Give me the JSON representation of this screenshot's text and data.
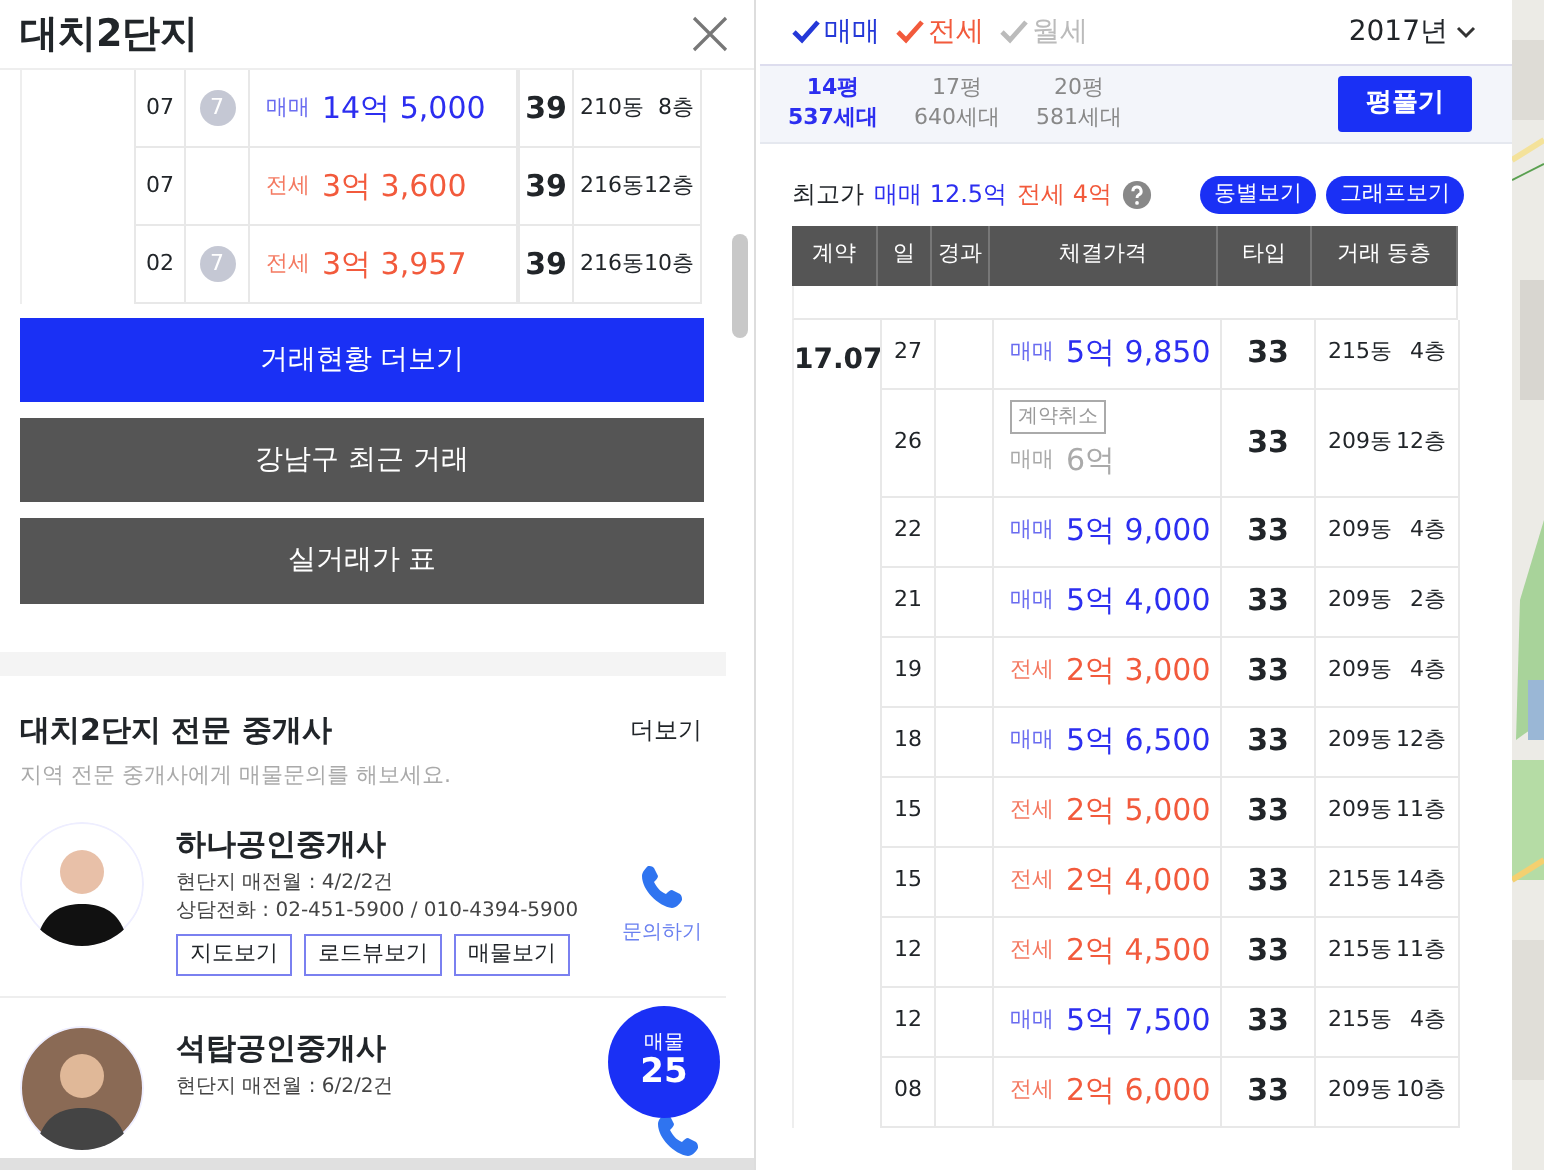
{
  "title": "대치2단지",
  "recent_trades": [
    {
      "day": "07",
      "badge": "7",
      "deal": "매매",
      "kind": "sale",
      "price": "14억 5,000",
      "type": "39",
      "building": "210동",
      "floor": "8층"
    },
    {
      "day": "07",
      "deal": "전세",
      "kind": "jeonse",
      "price": "3억 3,600",
      "type": "39",
      "building": "216동",
      "floor": "12층"
    },
    {
      "day": "02",
      "badge": "7",
      "deal": "전세",
      "kind": "jeonse",
      "price": "3억 3,957",
      "type": "39",
      "building": "216동",
      "floor": "10층"
    }
  ],
  "buttons": [
    {
      "label": "거래현황 더보기",
      "primary": true
    },
    {
      "label": "강남구 최근 거래",
      "primary": false
    },
    {
      "label": "실거래가 표",
      "primary": false
    }
  ],
  "agents_section": {
    "title": "대치2단지 전문 중개사",
    "more": "더보기",
    "subtitle": "지역 전문 중개사에게 매물문의를 해보세요."
  },
  "agents": [
    {
      "name": "하나공인중개사",
      "lines": [
        "현단지 매전월 : 4/2/2건",
        "상담전화 : 02-451-5900 / 010-4394-5900"
      ],
      "actions": [
        "지도보기",
        "로드뷰보기",
        "매물보기"
      ],
      "inquiry": "문의하기"
    },
    {
      "name": "석탑공인중개사",
      "lines": [
        "현단지 매전월 : 6/2/2건"
      ]
    }
  ],
  "listing_badge": {
    "label": "매물",
    "count": "25"
  },
  "filters": [
    {
      "label": "매매",
      "checked": true,
      "color": "#2438d8"
    },
    {
      "label": "전세",
      "checked": true,
      "color": "#f25a3c"
    },
    {
      "label": "월세",
      "checked": false
    }
  ],
  "year": "2017년",
  "sizes": [
    {
      "area": "14평",
      "households": "537세대",
      "selected": true
    },
    {
      "area": "17평",
      "households": "640세대",
      "selected": false
    },
    {
      "area": "20평",
      "households": "581세대",
      "selected": false
    }
  ],
  "size_button": "평풀기",
  "max_price": {
    "label": "최고가",
    "sale": "매매 12.5억",
    "jeonse": "전세 4억"
  },
  "view_buttons": [
    "동별보기",
    "그래프보기"
  ],
  "table": {
    "columns": [
      "계약",
      "일",
      "경과",
      "체결가격",
      "타입",
      "거래 동층"
    ],
    "month": "17.07",
    "rows": [
      {
        "day": "27",
        "deal": "매매",
        "kind": "sale",
        "price": "5억 9,850",
        "type": "33",
        "building": "215동",
        "floor": "4층"
      },
      {
        "day": "26",
        "cancelled": true,
        "cancel_label": "계약취소",
        "deal": "매매",
        "kind": "sale",
        "price": "6억",
        "type": "33",
        "building": "209동",
        "floor": "12층"
      },
      {
        "day": "22",
        "deal": "매매",
        "kind": "sale",
        "price": "5억 9,000",
        "type": "33",
        "building": "209동",
        "floor": "4층"
      },
      {
        "day": "21",
        "deal": "매매",
        "kind": "sale",
        "price": "5억 4,000",
        "type": "33",
        "building": "209동",
        "floor": "2층"
      },
      {
        "day": "19",
        "deal": "전세",
        "kind": "jeonse",
        "price": "2억 3,000",
        "type": "33",
        "building": "209동",
        "floor": "4층"
      },
      {
        "day": "18",
        "deal": "매매",
        "kind": "sale",
        "price": "5억 6,500",
        "type": "33",
        "building": "209동",
        "floor": "12층"
      },
      {
        "day": "15",
        "deal": "전세",
        "kind": "jeonse",
        "price": "2억 5,000",
        "type": "33",
        "building": "209동",
        "floor": "11층"
      },
      {
        "day": "15",
        "deal": "전세",
        "kind": "jeonse",
        "price": "2억 4,000",
        "type": "33",
        "building": "215동",
        "floor": "14층"
      },
      {
        "day": "12",
        "deal": "전세",
        "kind": "jeonse",
        "price": "2억 4,500",
        "type": "33",
        "building": "215동",
        "floor": "11층"
      },
      {
        "day": "12",
        "deal": "매매",
        "kind": "sale",
        "price": "5억 7,500",
        "type": "33",
        "building": "215동",
        "floor": "4층"
      },
      {
        "day": "08",
        "deal": "전세",
        "kind": "jeonse",
        "price": "2억 6,000",
        "type": "33",
        "building": "209동",
        "floor": "10층"
      }
    ]
  }
}
